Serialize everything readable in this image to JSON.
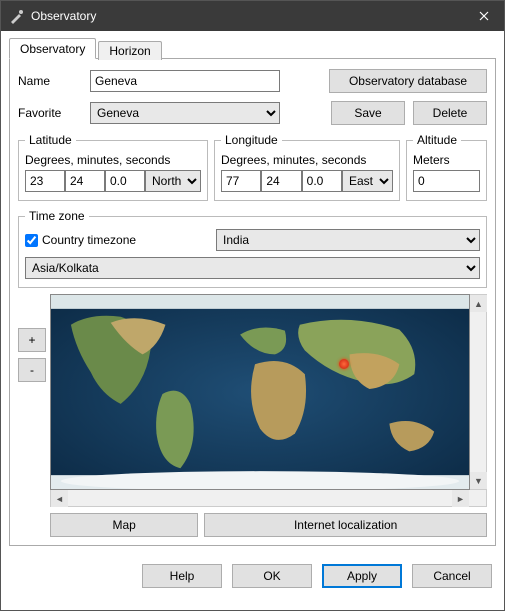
{
  "window": {
    "title": "Observatory"
  },
  "tabs": {
    "observatory": "Observatory",
    "horizon": "Horizon"
  },
  "form": {
    "name_label": "Name",
    "name_value": "Geneva",
    "favorite_label": "Favorite",
    "favorite_value": "Geneva",
    "db_button": "Observatory database",
    "save_button": "Save",
    "delete_button": "Delete"
  },
  "latitude": {
    "legend": "Latitude",
    "sublabel": "Degrees, minutes, seconds",
    "deg": "23",
    "min": "24",
    "sec": "0.0",
    "hemi": "North"
  },
  "longitude": {
    "legend": "Longitude",
    "sublabel": "Degrees, minutes, seconds",
    "deg": "77",
    "min": "24",
    "sec": "0.0",
    "hemi": "East"
  },
  "altitude": {
    "legend": "Altitude",
    "sublabel": "Meters",
    "value": "0"
  },
  "timezone": {
    "legend": "Time zone",
    "country_cb_label": "Country timezone",
    "country_value": "India",
    "tz_value": "Asia/Kolkata"
  },
  "map": {
    "zoom_in": "+",
    "zoom_out": "-",
    "map_button": "Map",
    "internet_button": "Internet localization",
    "marker": {
      "left_pct": 69,
      "top_pct": 33
    }
  },
  "footer": {
    "help": "Help",
    "ok": "OK",
    "apply": "Apply",
    "cancel": "Cancel"
  }
}
